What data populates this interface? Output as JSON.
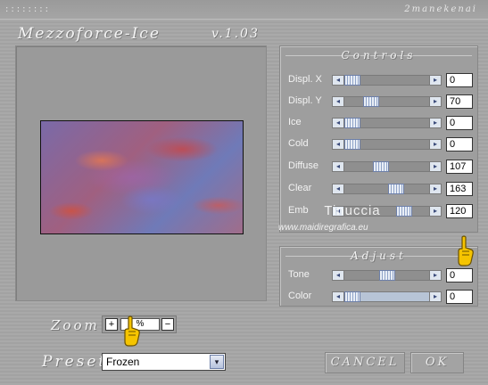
{
  "top_bar": {
    "dots": "::::::::",
    "author": "2manekenai"
  },
  "title": "Mezzoforce-Ice",
  "version": "v.1.03",
  "controls": {
    "title": "Controls",
    "rows": [
      {
        "label": "Displ. X",
        "value": "0",
        "level": 0.0
      },
      {
        "label": "Displ. Y",
        "value": "70",
        "level": 0.27
      },
      {
        "label": "Ice",
        "value": "0",
        "level": 0.0
      },
      {
        "label": "Cold",
        "value": "0",
        "level": 0.0
      },
      {
        "label": "Diffuse",
        "value": "107",
        "level": 0.42
      },
      {
        "label": "Clear",
        "value": "163",
        "level": 0.64
      },
      {
        "label": "Emb",
        "value": "120",
        "level": 0.75
      }
    ]
  },
  "watermark": {
    "name": "Tinuccia",
    "url": "www.maidiregrafica.eu"
  },
  "adjust": {
    "title": "Adjust",
    "rows": [
      {
        "label": "Tone",
        "value": "0",
        "level": 0.5
      },
      {
        "label": "Color",
        "value": "0",
        "level": 0.0
      }
    ]
  },
  "zoom": {
    "label": "Zoom",
    "value": "%",
    "plus": "+",
    "minus": "−"
  },
  "preset": {
    "label": "Preset",
    "selected": "Frozen",
    "dropdown_glyph": "▾"
  },
  "buttons": {
    "cancel": "CANCEL",
    "ok": "OK"
  },
  "colors": {
    "accent": "#b7c4d6",
    "panel": "#9e9e9e",
    "hand": "#f5c400"
  }
}
